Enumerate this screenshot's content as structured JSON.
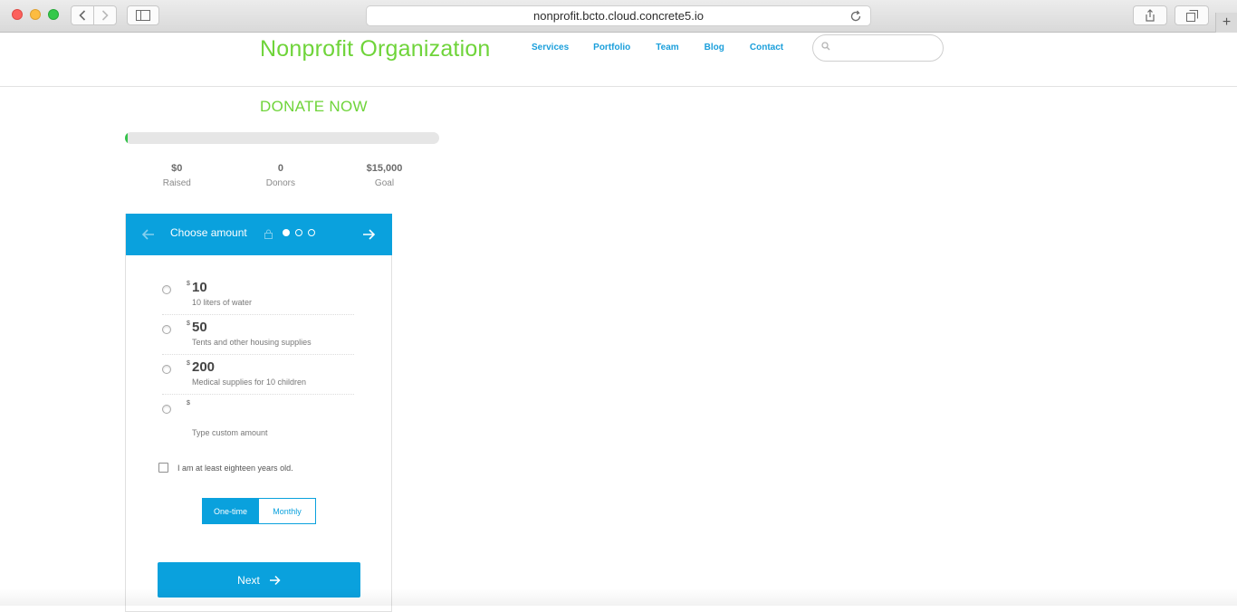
{
  "browser": {
    "url": "nonprofit.bcto.cloud.concrete5.io",
    "new_tab": "+"
  },
  "site": {
    "title": "Nonprofit Organization",
    "nav": [
      "Services",
      "Portfolio",
      "Team",
      "Blog",
      "Contact"
    ],
    "search_placeholder": ""
  },
  "donate": {
    "heading": "DONATE NOW",
    "progress_fraction": 0.0,
    "stats": [
      {
        "value": "$0",
        "label": "Raised"
      },
      {
        "value": "0",
        "label": "Donors"
      },
      {
        "value": "$15,000",
        "label": "Goal"
      }
    ],
    "step_title": "Choose amount",
    "steps_total": 3,
    "step_current": 1,
    "currency": "$",
    "options": [
      {
        "amount": "10",
        "desc": "10 liters of water"
      },
      {
        "amount": "50",
        "desc": "Tents and other housing supplies"
      },
      {
        "amount": "200",
        "desc": "Medical supplies for 10 children"
      }
    ],
    "custom_placeholder": "Type custom amount",
    "age_label": "I am at least eighteen years old.",
    "frequency": {
      "one_time": "One-time",
      "monthly": "Monthly",
      "selected": "One-time"
    },
    "next_label": "Next"
  },
  "colors": {
    "brand_green": "#6fd43a",
    "brand_blue": "#0aa1dd",
    "nav_blue": "#1b9fdb"
  }
}
